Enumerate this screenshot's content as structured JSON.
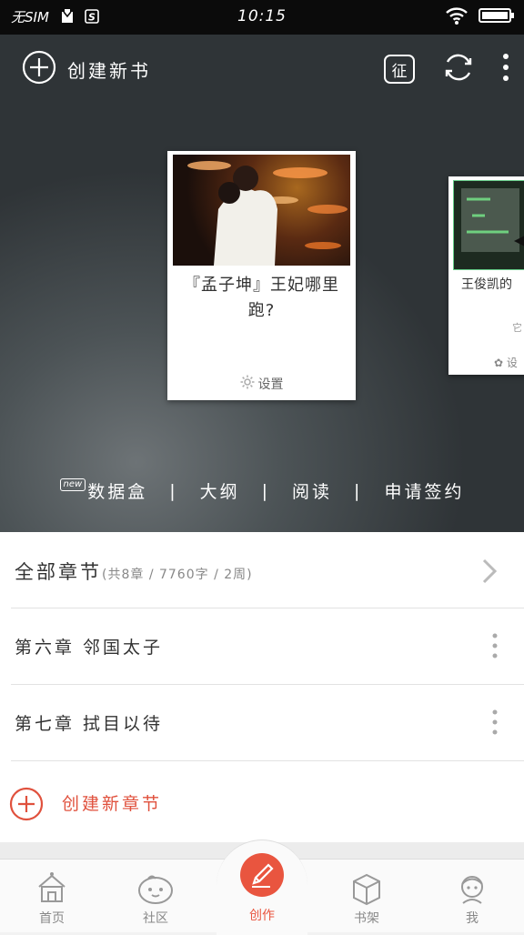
{
  "statusbar": {
    "carrier": "无SIM",
    "time": "10:15"
  },
  "header": {
    "create_label": "创建新书",
    "zheng_label": "征"
  },
  "books": [
    {
      "title": "『孟子坤』王妃哪里跑?",
      "settings_label": "设置"
    },
    {
      "title": "王俊凯的",
      "settings_label": "设",
      "extra": "它"
    }
  ],
  "actions": {
    "new_badge": "new",
    "databox": "数据盒",
    "outline": "大纲",
    "read": "阅读",
    "apply": "申请签约",
    "separator": "|"
  },
  "chapters": {
    "all_label": "全部章节",
    "stats": "(共8章 / 7760字 / 2周)",
    "items": [
      {
        "title": "第六章 邻国太子"
      },
      {
        "title": "第七章 拭目以待"
      }
    ],
    "create_label": "创建新章节"
  },
  "tabs": [
    {
      "label": "首页",
      "icon": "home-icon"
    },
    {
      "label": "社区",
      "icon": "community-icon"
    },
    {
      "label": "创作",
      "icon": "pen-icon"
    },
    {
      "label": "书架",
      "icon": "bookshelf-icon"
    },
    {
      "label": "我",
      "icon": "profile-icon"
    }
  ],
  "colors": {
    "accent": "#e9553f",
    "hero_dark": "#2f3437",
    "status_bar": "#0b0b0b"
  }
}
